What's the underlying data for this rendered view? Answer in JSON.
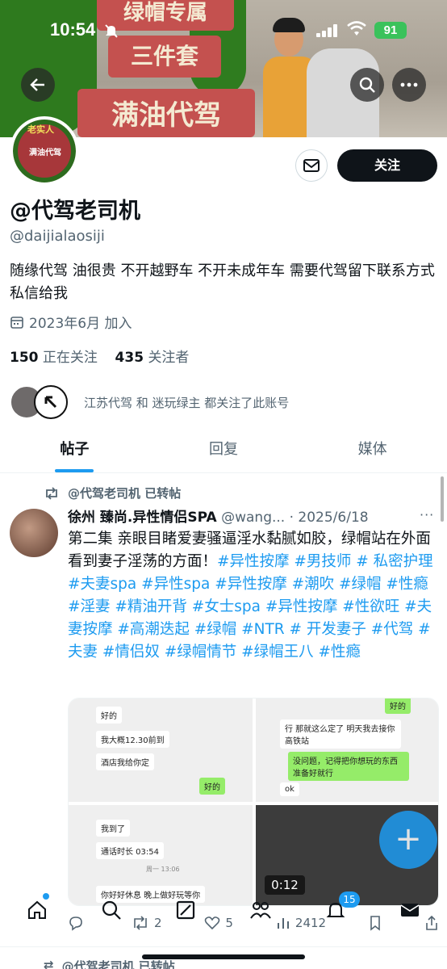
{
  "status_bar": {
    "time": "10:54",
    "battery": "91"
  },
  "banner": {
    "line1": "绿帽专属",
    "line2": "三件套",
    "line3": "满油代驾"
  },
  "avatar": {
    "top_text": "老实人",
    "mid_text": "满油代驾"
  },
  "profile": {
    "follow_label": "关注",
    "display_name": "@代驾老司机",
    "handle": "@daijialaosiji",
    "bio": "随缘代驾 油很贵 不开越野车 不开未成年车 需要代驾留下联系方式私信给我",
    "joined": "2023年6月 加入",
    "following_count": "150",
    "following_label": "正在关注",
    "followers_count": "435",
    "followers_label": "关注者",
    "followed_by": "江苏代驾 和 迷玩绿主 都关注了此账号"
  },
  "tabs": [
    {
      "label": "帖子"
    },
    {
      "label": "回复"
    },
    {
      "label": "媒体"
    }
  ],
  "post": {
    "repost_label": "@代驾老司机 已转帖",
    "author_name": "徐州 臻尚.异性情侣SPA",
    "author_meta": "@wang... · 2025/6/18",
    "text_main": "第二集  亲眼目睹爱妻骚逼淫水黏腻如胶，绿帽站在外面看到妻子淫荡的方面！",
    "hashtags": "#异性按摩 #男技师 # 私密护理 #夫妻spa #异性spa #异性按摩 #潮吹 #绿帽 #性瘾 #淫妻 #精油开背 #女士spa #异性按摩 #性欲旺 #夫妻按摩 #高潮迭起 #绿帽 #NTR # 开发妻子 #代驾 #夫妻 #情侣奴 #绿帽情节 #绿帽王八 #性瘾",
    "media": {
      "chat1": [
        "好的",
        "我大概12.30前到",
        "酒店我给你定",
        "好的"
      ],
      "chat2": [
        "好的",
        "行 那就这么定了 明天我去接你高铁站",
        "没问题，记得把你想玩的东西准备好就行",
        "ok"
      ],
      "chat3": [
        "我到了",
        "通话时长 03:54",
        "周一 13:06",
        "你好好休息 晚上做好玩等你"
      ],
      "video_time": "0:12"
    },
    "actions": {
      "reply": "",
      "repost": "2",
      "like": "5",
      "views": "2412"
    }
  },
  "bottom_nav": {
    "notifications_badge": "15"
  },
  "next_post": {
    "repost_label": "@代驾老司机 已转帖"
  }
}
